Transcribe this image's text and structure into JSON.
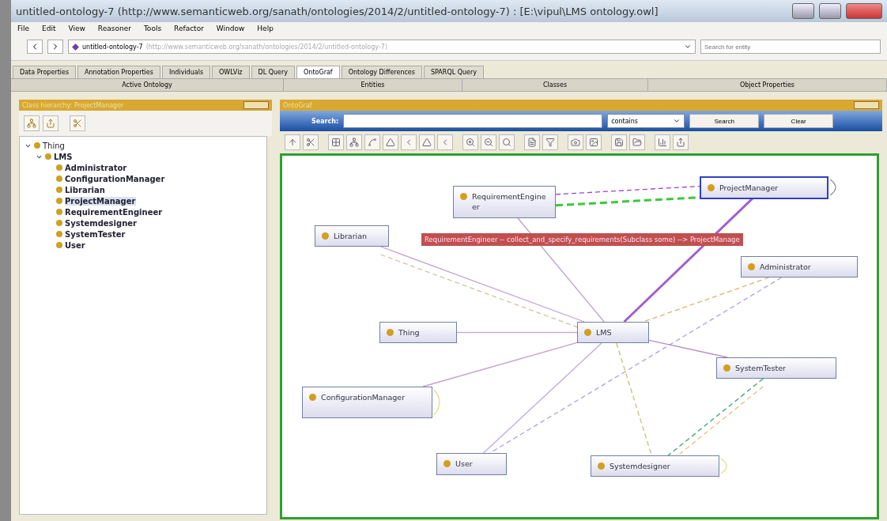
{
  "window": {
    "title": "untitled-ontology-7 (http://www.semanticweb.org/sanath/ontologies/2014/2/untitled-ontology-7) : [E:\\vipul\\LMS ontology.owl]"
  },
  "menu": [
    "File",
    "Edit",
    "View",
    "Reasoner",
    "Tools",
    "Refactor",
    "Window",
    "Help"
  ],
  "address": {
    "name": "untitled-ontology-7",
    "iri": "(http://www.semanticweb.org/sanath/ontologies/2014/2/untitled-ontology-7)",
    "search_placeholder": "Search for entity"
  },
  "tabs": [
    {
      "label": "Data Properties",
      "selected": false
    },
    {
      "label": "Annotation Properties",
      "selected": false
    },
    {
      "label": "Individuals",
      "selected": false
    },
    {
      "label": "OWLViz",
      "selected": false
    },
    {
      "label": "DL Query",
      "selected": false
    },
    {
      "label": "OntoGraf",
      "selected": true
    },
    {
      "label": "Ontology Differences",
      "selected": false
    },
    {
      "label": "SPARQL Query",
      "selected": false
    }
  ],
  "tabs_row_2": [
    {
      "label": "Active Ontology",
      "selected": false
    },
    {
      "label": "Entities",
      "selected": false
    },
    {
      "label": "Classes",
      "selected": false
    },
    {
      "label": "Object Properties",
      "selected": false
    }
  ],
  "class_hierarchy": {
    "title": "Class hierarchy: ProjectManager",
    "tree": [
      {
        "label": "Thing",
        "expanded": true,
        "selected": false,
        "children": [
          {
            "label": "LMS",
            "expanded": true,
            "selected": false,
            "children": [
              {
                "label": "Administrator",
                "selected": false
              },
              {
                "label": "ConfigurationManager",
                "selected": false
              },
              {
                "label": "Librarian",
                "selected": false
              },
              {
                "label": "ProjectManager",
                "selected": true
              },
              {
                "label": "RequirementEngineer",
                "selected": false
              },
              {
                "label": "Systemdesigner",
                "selected": false
              },
              {
                "label": "SystemTester",
                "selected": false
              },
              {
                "label": "User",
                "selected": false
              }
            ]
          }
        ]
      }
    ]
  },
  "ontograf": {
    "title": "OntoGraf",
    "search_label": "Search:",
    "match": "contains",
    "buttons": [
      "Search",
      "Clear"
    ],
    "nodes": [
      {
        "label": "RequirementEngineer",
        "selected": false
      },
      {
        "label": "ProjectManager",
        "selected": true
      },
      {
        "label": "Librarian",
        "selected": false
      },
      {
        "label": "Administrator",
        "selected": false
      },
      {
        "label": "Thing",
        "selected": false
      },
      {
        "label": "LMS",
        "selected": false
      },
      {
        "label": "SystemTester",
        "selected": false
      },
      {
        "label": "ConfigurationManager",
        "selected": false
      },
      {
        "label": "User",
        "selected": false
      },
      {
        "label": "Systemdesigner",
        "selected": false
      }
    ],
    "tooltip": "RequirementEngineer -- collect_and_specify_requirements(Subclass some) --> ProjectManage"
  }
}
